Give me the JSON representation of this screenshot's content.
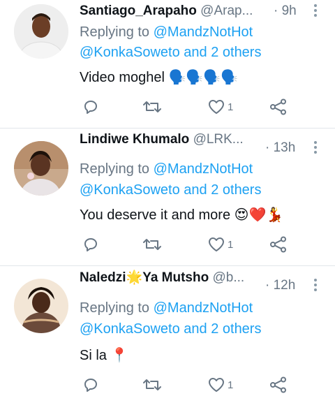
{
  "colors": {
    "link": "#1da1f2",
    "muted": "#687684",
    "text": "#0f1419",
    "heart": "#e0245e"
  },
  "tweets": [
    {
      "name": "Santiago_Arapaho",
      "handle": "@Arap...",
      "time": "· 9h",
      "replying_prefix": "Replying to ",
      "replying_to": "@MandzNotHot",
      "replying_line2": "@KonkaSoweto and 2 others",
      "text": "Video moghel",
      "emoji": "🗣️🗣️🗣️🗣️",
      "likes": "1",
      "icons": [
        "reply-icon",
        "retweet-icon",
        "heart-icon",
        "share-icon",
        "more-icon"
      ]
    },
    {
      "name": "Lindiwe Khumalo",
      "handle": "@LRK...",
      "time": "· 13h",
      "replying_prefix": "Replying to ",
      "replying_to": "@MandzNotHot",
      "replying_line2": "@KonkaSoweto and 2 others",
      "text": "You deserve it and more ",
      "emoji": "😍❤️💃",
      "likes": "1",
      "icons": [
        "reply-icon",
        "retweet-icon",
        "heart-icon",
        "share-icon",
        "more-icon"
      ]
    },
    {
      "name": "Naledzi",
      "name_emoji": "🌟",
      "name_suffix": "Ya Mutsho",
      "handle": "@b...",
      "time": "· 12h",
      "replying_prefix": "Replying to ",
      "replying_to": "@MandzNotHot",
      "replying_line2": "@KonkaSoweto and 2 others",
      "text": "Si la ",
      "emoji": "📍",
      "likes": "1",
      "icons": [
        "reply-icon",
        "retweet-icon",
        "heart-icon",
        "share-icon",
        "more-icon"
      ]
    }
  ]
}
